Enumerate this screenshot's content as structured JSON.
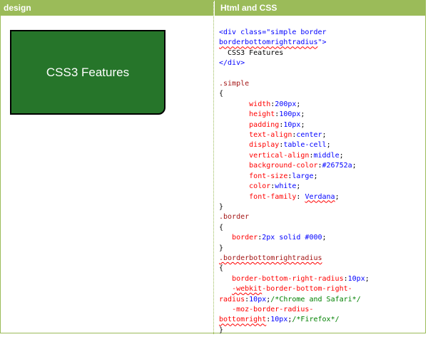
{
  "headers": {
    "design": "design",
    "html_css": "Html and CSS"
  },
  "demo_box": {
    "text": "CSS3 Features",
    "background": "#26752a"
  },
  "code": {
    "l1a": "<div class=\"simple border",
    "l2a": "borderbottomrightradius",
    "l2b": "\">",
    "l3": "  CSS3 Features",
    "l4": "</div>",
    "l6": ".simple",
    "l7": "{",
    "l8p": "width",
    "l8v": "200px",
    "l9p": "height",
    "l9v": "100px",
    "l10p": "padding",
    "l10v": "10px",
    "l11p": "text-align",
    "l11v": "center",
    "l12p": "display",
    "l12v": "table-cell",
    "l13p": "vertical-align",
    "l13v": "middle",
    "l14p": "background-color",
    "l14v": "#26752a",
    "l15p": "font-size",
    "l15v": "large",
    "l16p": "color",
    "l16v": "white",
    "l17p": "font-family",
    "l17v": "Verdana",
    "l18": "}",
    "l19": ".border",
    "l20": "{",
    "l21p": "border",
    "l21v": "2px solid #000",
    "l22": "}",
    "l23": ".borderbottomrightradius",
    "l24": "{",
    "l25p": "border-bottom-right-radius",
    "l25v": "10px",
    "l26a": "-webkit",
    "l26b": "-border-bottom-right-",
    "l27a": "radius",
    "l27v": "10px",
    "l27c": "/*Chrome and Safari*/",
    "l28a": "-moz-border-radius-",
    "l29a": "bottomright",
    "l29v": "10px",
    "l29c": "/*Firefox*/",
    "l30": "}"
  }
}
